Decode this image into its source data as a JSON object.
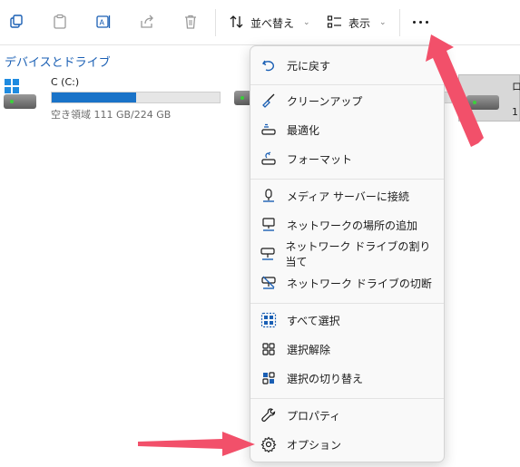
{
  "toolbar": {
    "icons": [
      "copy-icon",
      "paste-icon",
      "rename-icon",
      "share-icon",
      "delete-icon"
    ],
    "sort_label": "並べ替え",
    "view_label": "表示"
  },
  "section": {
    "title": "デバイスとドライブ"
  },
  "drive_c": {
    "name": "C (C:)",
    "free_text": "空き領域 111 GB/224 GB",
    "used_fraction": 0.5
  },
  "drive3": {
    "label_top": "ロ",
    "label_bottom": "1"
  },
  "context_menu": {
    "items": [
      {
        "label": "元に戻す",
        "icon": "undo-icon"
      },
      {
        "label": "クリーンアップ",
        "icon": "broom-icon"
      },
      {
        "label": "最適化",
        "icon": "optimize-icon"
      },
      {
        "label": "フォーマット",
        "icon": "format-icon"
      },
      {
        "label": "メディア サーバーに接続",
        "icon": "media-server-icon"
      },
      {
        "label": "ネットワークの場所の追加",
        "icon": "network-location-icon"
      },
      {
        "label": "ネットワーク ドライブの割り当て",
        "icon": "map-network-drive-icon"
      },
      {
        "label": "ネットワーク ドライブの切断",
        "icon": "disconnect-network-drive-icon"
      },
      {
        "label": "すべて選択",
        "icon": "select-all-icon"
      },
      {
        "label": "選択解除",
        "icon": "select-none-icon"
      },
      {
        "label": "選択の切り替え",
        "icon": "invert-selection-icon"
      },
      {
        "label": "プロパティ",
        "icon": "wrench-icon"
      },
      {
        "label": "オプション",
        "icon": "gear-icon"
      }
    ]
  },
  "colors": {
    "accent": "#1a73c8",
    "arrow": "#f2506a",
    "link": "#1a5fb4"
  }
}
